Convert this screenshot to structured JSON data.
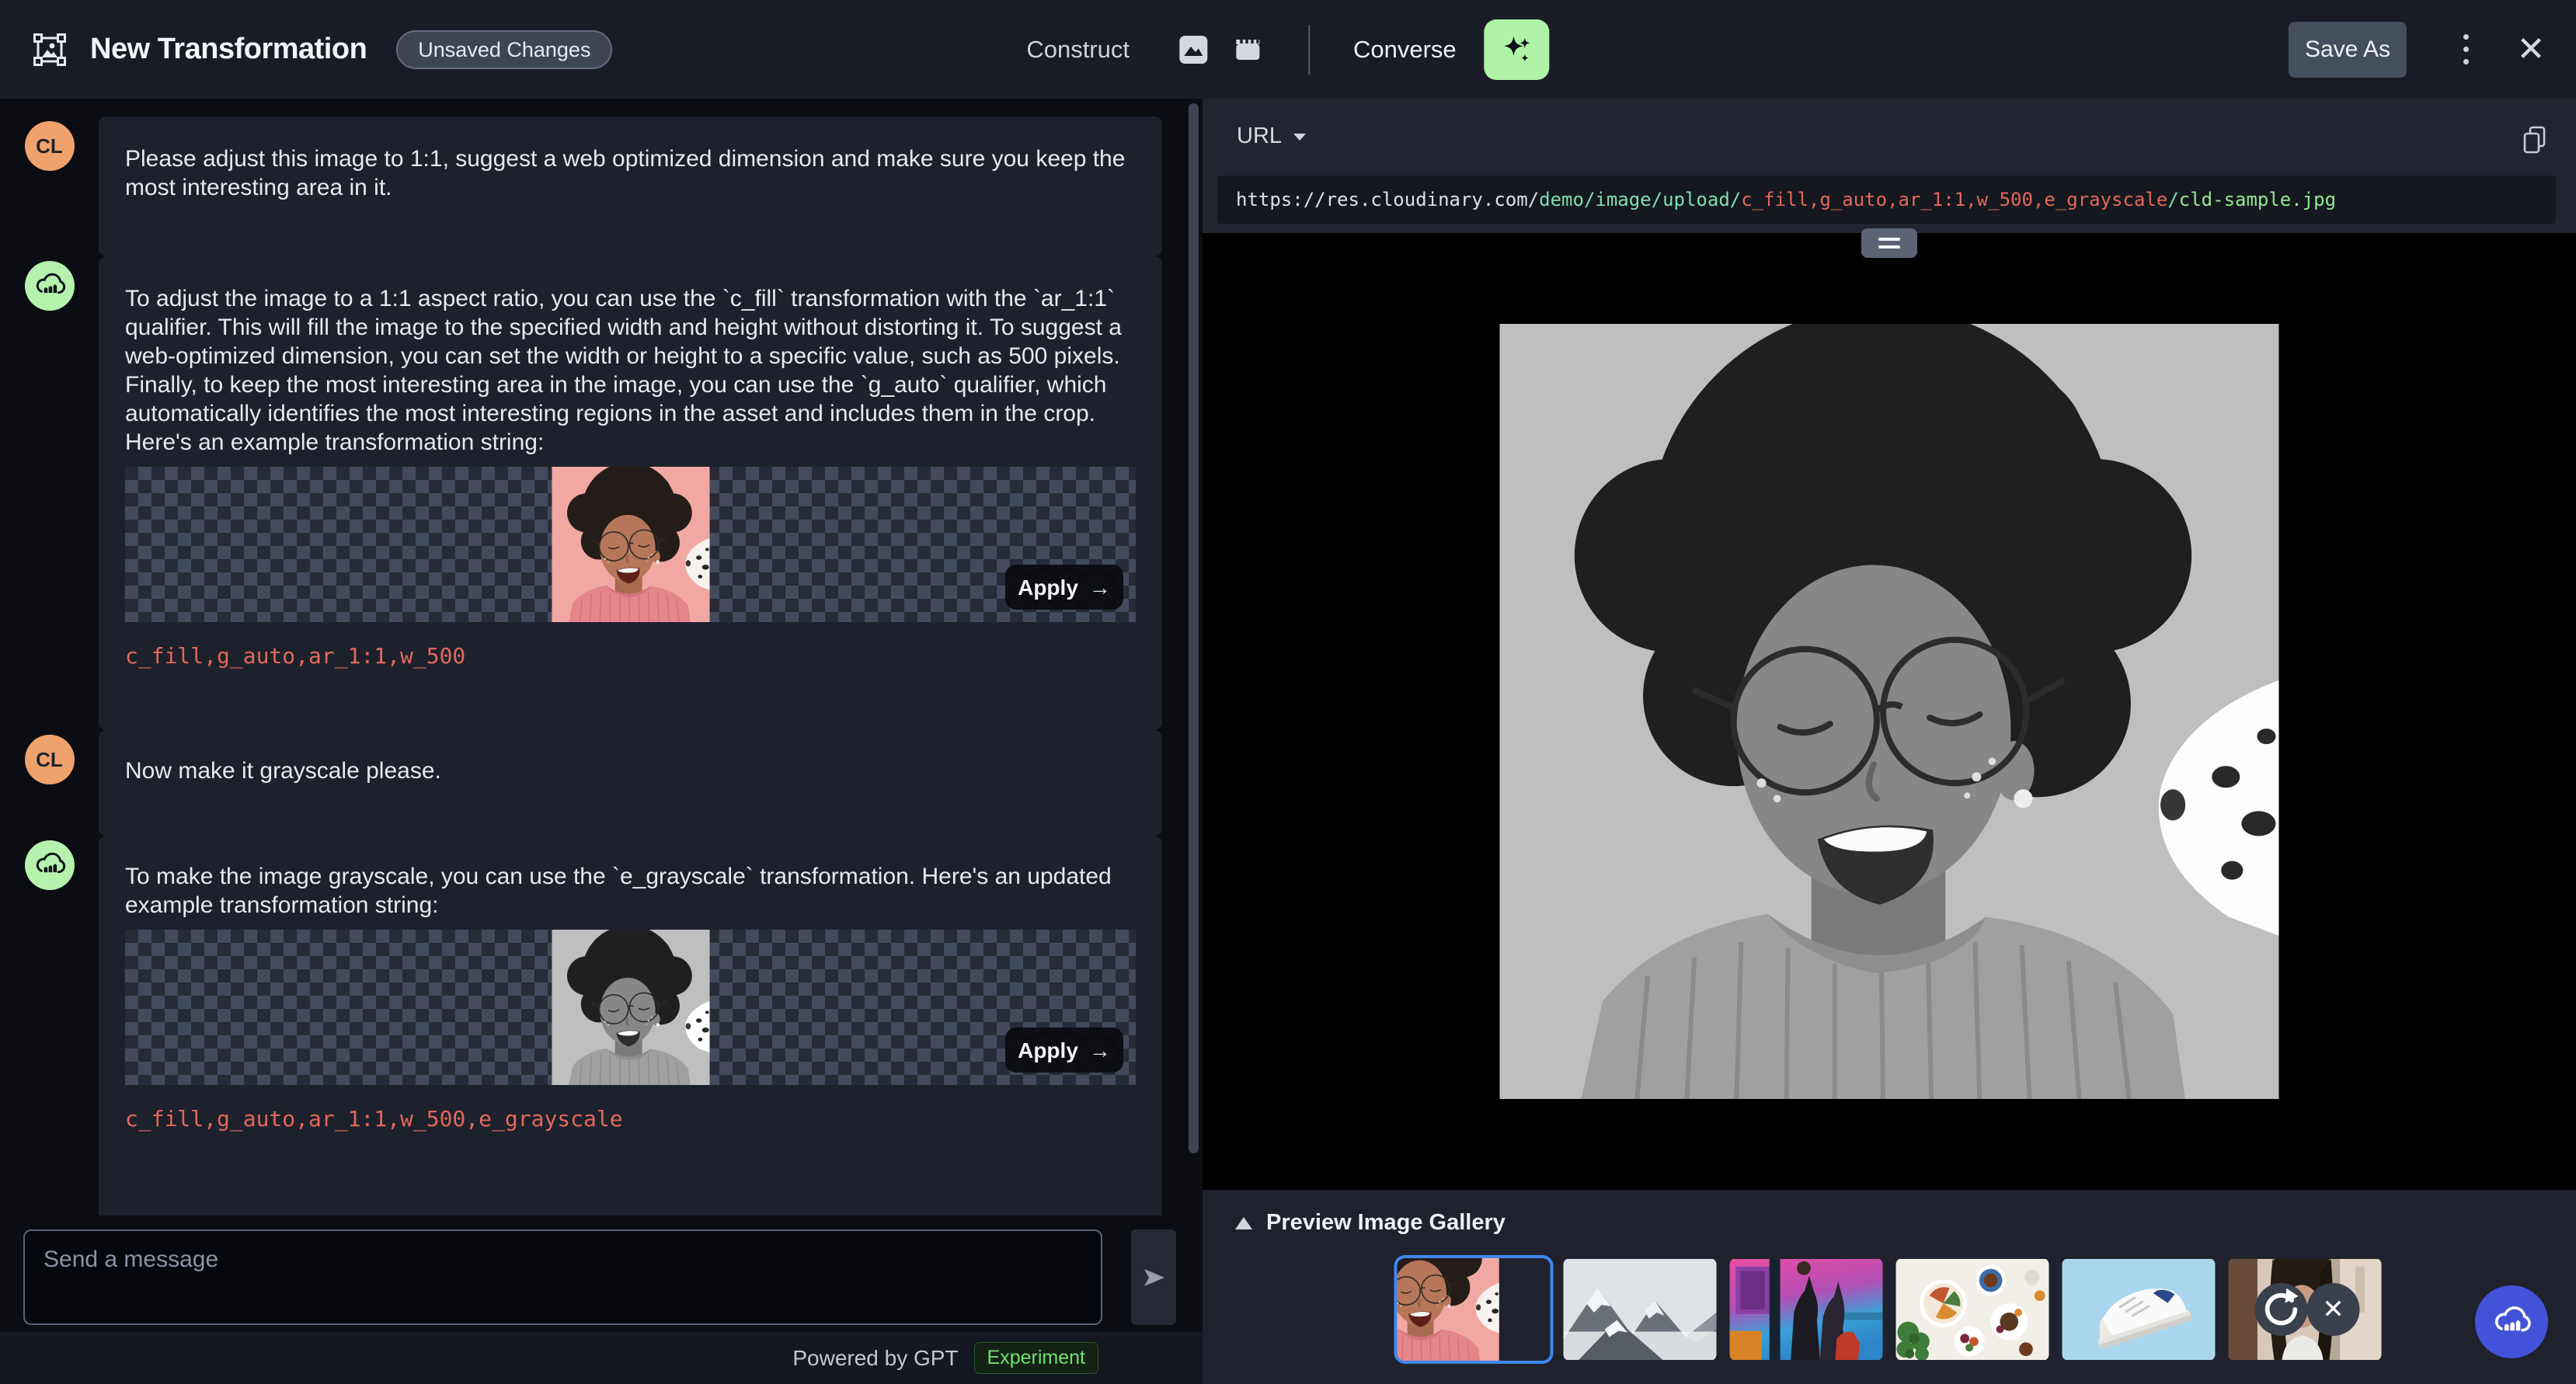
{
  "header": {
    "title": "New Transformation",
    "badge": "Unsaved Changes",
    "construct_label": "Construct",
    "converse_label": "Converse",
    "save_as_label": "Save As"
  },
  "chat": {
    "messages": [
      {
        "role": "user",
        "initials": "CL",
        "text": "Please adjust this image to 1:1, suggest a web optimized dimension and make sure you keep the most interesting area in it."
      },
      {
        "role": "assistant",
        "text": "To adjust the image to a 1:1 aspect ratio, you can use the `c_fill` transformation with the `ar_1:1` qualifier. This will fill the image to the specified width and height without distorting it. To suggest a web-optimized dimension, you can set the width or height to a specific value, such as 500 pixels. Finally, to keep the most interesting area in the image, you can use the `g_auto` qualifier, which automatically identifies the most interesting regions in the asset and includes them in the crop. Here's an example transformation string:",
        "code": "c_fill,g_auto,ar_1:1,w_500",
        "apply_label": "Apply",
        "apply_arrow": "→"
      },
      {
        "role": "user",
        "initials": "CL",
        "text": "Now make it grayscale please."
      },
      {
        "role": "assistant",
        "text": "To make the image grayscale, you can use the `e_grayscale` transformation. Here's an updated example transformation string:",
        "code": "c_fill,g_auto,ar_1:1,w_500,e_grayscale",
        "apply_label": "Apply",
        "apply_arrow": "→"
      }
    ]
  },
  "composer": {
    "placeholder": "Send a message",
    "powered_by": "Powered by GPT",
    "experiment_badge": "Experiment"
  },
  "url_bar": {
    "label": "URL",
    "segments": [
      {
        "text": "https://res.cloudinary.com/",
        "color": "#dde1e7"
      },
      {
        "text": "demo/image/upload/",
        "color": "#7ee0b0"
      },
      {
        "text": "c_fill,g_auto,ar_1:1,w_500,e_grayscale",
        "color": "#e2685b"
      },
      {
        "text": "/",
        "color": "#7ee0b0"
      },
      {
        "text": "cld-sample.jpg",
        "color": "#93e893"
      }
    ]
  },
  "gallery": {
    "title": "Preview Image Gallery",
    "selected_index": 0,
    "thumbnails": [
      "laughing-woman-pink",
      "snowy-mountains",
      "basketball-players",
      "food-flatlay",
      "white-sneaker",
      "woman-portrait"
    ]
  },
  "colors": {
    "accent_green": "#aef3a6",
    "selected_blue": "#3f86f4",
    "fab_blue": "#4352d8",
    "code_salmon": "#e2685b",
    "url_path_mint": "#7ee0b0",
    "url_file_green": "#93e893",
    "user_avatar_orange": "#f0a26d",
    "header_bg": "#191c24",
    "panel_bg": "#22252f",
    "bubble_bg": "#1d212b"
  }
}
